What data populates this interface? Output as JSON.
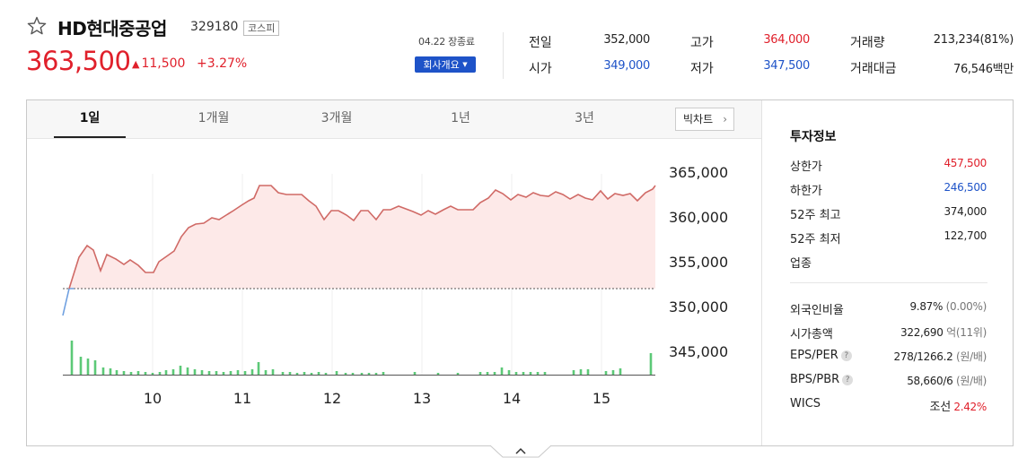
{
  "header": {
    "name": "HD현대중공업",
    "code": "329180",
    "market": "코스피",
    "price": "363,500",
    "change": "11,500",
    "change_pct": "+3.27%",
    "date_status": "04.22 장종료",
    "overview_button": "회사개요"
  },
  "summary": [
    {
      "label": "전일",
      "value": "352,000",
      "tone": "neutral"
    },
    {
      "label": "시가",
      "value": "349,000",
      "tone": "down"
    },
    {
      "label": "고가",
      "value": "364,000",
      "tone": "up"
    },
    {
      "label": "저가",
      "value": "347,500",
      "tone": "down"
    },
    {
      "label": "거래량",
      "value": "213,234(81%)",
      "tone": "neutral"
    },
    {
      "label": "거래대금",
      "value": "76,546백만",
      "tone": "neutral"
    }
  ],
  "tabs": [
    "1일",
    "1개월",
    "3개월",
    "1년",
    "3년"
  ],
  "active_tab": "1일",
  "big_chart_button": "빅차트",
  "colors": {
    "up": "#e0202b",
    "down": "#1e53c8",
    "line": "#d06a66",
    "fill": "#fde9e8",
    "volume": "#5cc977"
  },
  "icons": {
    "favorite": "star-outline-icon",
    "overview_dropdown": "caret-down-icon",
    "big_chart": "chevron-right-icon",
    "help": "question-icon",
    "expand": "chevron-up-icon"
  },
  "investment": {
    "title": "투자정보",
    "rows": [
      {
        "label": "상한가",
        "value": "457,500",
        "tone": "up"
      },
      {
        "label": "하한가",
        "value": "246,500",
        "tone": "down"
      },
      {
        "label": "52주 최고",
        "value": "374,000",
        "tone": "neutral"
      },
      {
        "label": "52주 최저",
        "value": "122,700",
        "tone": "neutral"
      },
      {
        "label": "업종",
        "value": "",
        "tone": "neutral"
      }
    ],
    "metrics": [
      {
        "label": "외국인비율",
        "value": "9.87%",
        "sub": "(0.00%)",
        "help": false
      },
      {
        "label": "시가총액",
        "value": "322,690",
        "sub": "억(11위)",
        "help": false
      },
      {
        "label": "EPS/PER",
        "value": "278/1266.2",
        "sub": "(원/배)",
        "help": true
      },
      {
        "label": "BPS/PBR",
        "value": "58,660/6",
        "sub": "(원/배)",
        "help": true
      },
      {
        "label": "WICS",
        "value": "조선",
        "sub": "2.42%",
        "help": false
      }
    ]
  },
  "chart_data": {
    "type": "line",
    "title": "",
    "xlabel": "",
    "ylabel": "",
    "x_ticks": [
      "10",
      "11",
      "12",
      "13",
      "14",
      "15"
    ],
    "y_ticks": [
      "365,000",
      "360,000",
      "355,000",
      "350,000",
      "345,000"
    ],
    "ylim": [
      342500,
      367500
    ],
    "baseline": 352000,
    "x_range": [
      9.0,
      15.6
    ],
    "price": [
      [
        9.0,
        349000
      ],
      [
        9.07,
        352000
      ],
      [
        9.18,
        355500
      ],
      [
        9.27,
        356800
      ],
      [
        9.34,
        356300
      ],
      [
        9.42,
        354000
      ],
      [
        9.49,
        355800
      ],
      [
        9.59,
        355300
      ],
      [
        9.68,
        354700
      ],
      [
        9.75,
        355200
      ],
      [
        9.84,
        354600
      ],
      [
        9.92,
        353800
      ],
      [
        10.01,
        353800
      ],
      [
        10.07,
        355000
      ],
      [
        10.17,
        355700
      ],
      [
        10.24,
        356200
      ],
      [
        10.32,
        357800
      ],
      [
        10.4,
        358800
      ],
      [
        10.48,
        359200
      ],
      [
        10.57,
        359300
      ],
      [
        10.66,
        359900
      ],
      [
        10.74,
        359700
      ],
      [
        10.82,
        360200
      ],
      [
        10.9,
        360700
      ],
      [
        10.99,
        361300
      ],
      [
        11.07,
        361800
      ],
      [
        11.13,
        362100
      ],
      [
        11.19,
        363500
      ],
      [
        11.32,
        363500
      ],
      [
        11.4,
        362700
      ],
      [
        11.49,
        362500
      ],
      [
        11.58,
        362500
      ],
      [
        11.66,
        362500
      ],
      [
        11.74,
        361800
      ],
      [
        11.82,
        361200
      ],
      [
        11.91,
        359700
      ],
      [
        11.99,
        360700
      ],
      [
        12.07,
        360700
      ],
      [
        12.16,
        360200
      ],
      [
        12.24,
        359600
      ],
      [
        12.32,
        360700
      ],
      [
        12.4,
        360700
      ],
      [
        12.49,
        359700
      ],
      [
        12.57,
        360800
      ],
      [
        12.65,
        360800
      ],
      [
        12.74,
        361200
      ],
      [
        12.82,
        360900
      ],
      [
        12.9,
        360600
      ],
      [
        12.99,
        360200
      ],
      [
        13.07,
        360700
      ],
      [
        13.15,
        360300
      ],
      [
        13.24,
        360800
      ],
      [
        13.32,
        361200
      ],
      [
        13.4,
        360800
      ],
      [
        13.49,
        360800
      ],
      [
        13.57,
        360800
      ],
      [
        13.65,
        361600
      ],
      [
        13.74,
        362100
      ],
      [
        13.82,
        363000
      ],
      [
        13.9,
        362600
      ],
      [
        13.99,
        361900
      ],
      [
        14.07,
        362500
      ],
      [
        14.16,
        362200
      ],
      [
        14.24,
        362700
      ],
      [
        14.32,
        362400
      ],
      [
        14.41,
        362300
      ],
      [
        14.49,
        362800
      ],
      [
        14.57,
        362500
      ],
      [
        14.65,
        362000
      ],
      [
        14.74,
        362500
      ],
      [
        14.82,
        362100
      ],
      [
        14.9,
        361900
      ],
      [
        14.99,
        362900
      ],
      [
        15.07,
        362000
      ],
      [
        15.15,
        362600
      ],
      [
        15.24,
        362400
      ],
      [
        15.32,
        362600
      ],
      [
        15.4,
        361800
      ],
      [
        15.49,
        362700
      ],
      [
        15.57,
        363100
      ],
      [
        15.6,
        363500
      ]
    ],
    "volume": [
      [
        9.1,
        38
      ],
      [
        9.2,
        20
      ],
      [
        9.28,
        18
      ],
      [
        9.36,
        16
      ],
      [
        9.45,
        8
      ],
      [
        9.53,
        7
      ],
      [
        9.6,
        5
      ],
      [
        9.68,
        4
      ],
      [
        9.76,
        3
      ],
      [
        9.84,
        4
      ],
      [
        9.92,
        3
      ],
      [
        10.0,
        2
      ],
      [
        10.08,
        3
      ],
      [
        10.15,
        5
      ],
      [
        10.23,
        6
      ],
      [
        10.31,
        10
      ],
      [
        10.39,
        8
      ],
      [
        10.47,
        6
      ],
      [
        10.55,
        5
      ],
      [
        10.63,
        4
      ],
      [
        10.71,
        4
      ],
      [
        10.79,
        3
      ],
      [
        10.87,
        4
      ],
      [
        10.95,
        5
      ],
      [
        11.03,
        4
      ],
      [
        11.11,
        6
      ],
      [
        11.18,
        14
      ],
      [
        11.26,
        5
      ],
      [
        11.34,
        6
      ],
      [
        11.45,
        3
      ],
      [
        11.53,
        3
      ],
      [
        11.61,
        2
      ],
      [
        11.69,
        3
      ],
      [
        11.77,
        2
      ],
      [
        11.85,
        3
      ],
      [
        11.93,
        2
      ],
      [
        12.05,
        4
      ],
      [
        12.15,
        2
      ],
      [
        12.23,
        2
      ],
      [
        12.33,
        2
      ],
      [
        12.41,
        2
      ],
      [
        12.49,
        2
      ],
      [
        12.57,
        3
      ],
      [
        12.92,
        3
      ],
      [
        13.18,
        2
      ],
      [
        13.4,
        2
      ],
      [
        13.65,
        3
      ],
      [
        13.73,
        3
      ],
      [
        13.81,
        3
      ],
      [
        13.89,
        8
      ],
      [
        13.97,
        5
      ],
      [
        14.05,
        3
      ],
      [
        14.13,
        3
      ],
      [
        14.21,
        3
      ],
      [
        14.29,
        3
      ],
      [
        14.37,
        3
      ],
      [
        14.69,
        5
      ],
      [
        14.77,
        6
      ],
      [
        14.85,
        6
      ],
      [
        15.05,
        4
      ],
      [
        15.13,
        5
      ],
      [
        15.21,
        7
      ],
      [
        15.55,
        24
      ]
    ]
  },
  "expand_toggle": ""
}
